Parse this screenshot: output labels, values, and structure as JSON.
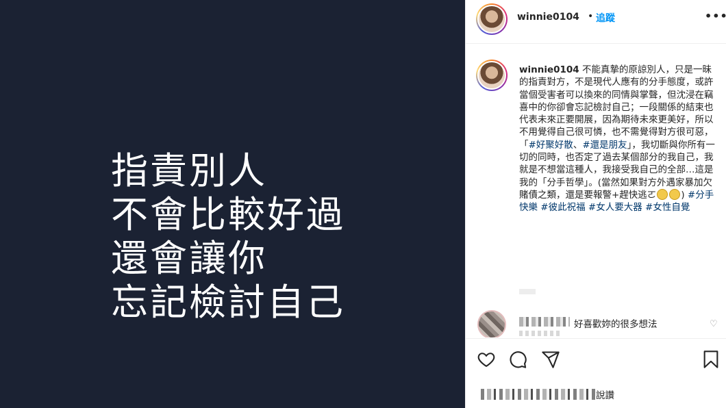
{
  "post_image": {
    "lines": [
      "指責別人",
      "不會比較好過",
      "還會讓你",
      "忘記檢討自己"
    ]
  },
  "header": {
    "username": "winnie0104",
    "separator": "•",
    "follow_label": "追蹤",
    "more_label": "•••"
  },
  "caption": {
    "username": "winnie0104",
    "text_1": "不能真摯的原諒別人，只是一昧的指責對方，不是現代人應有的分手態度，或許當個受害者可以換來的同情與掌聲，但沈浸在竊喜中的你卻會忘記檢討自己；一段關係的結束也代表未來正要開展，因為期待未來更美好，所以不用覺得自己很可憐，也不需覺得對方很可惡，「",
    "tag_1": "#好聚好散",
    "sep_1": "、",
    "tag_2": "#還是朋友",
    "text_2": "」，我切斷與你所有一切的同時，也否定了過去某個部分的我自己，我就是不想當這種人，我接受我自己的全部…這是我的「分手哲學」。(當然如果對方外遇家暴加欠賭債之類，還是要報警+趕快逃ㄛ",
    "text_3": ")",
    "tag_3": "#分手快樂",
    "tag_4": "#彼此祝福",
    "tag_5": "#女人要大器",
    "tag_6": "#女性自覺"
  },
  "reply": {
    "text": "好喜歡妳的很多想法",
    "heart_icon": "heart-outline-icon"
  },
  "actions": {
    "icons": [
      "heart-icon",
      "comment-icon",
      "share-icon",
      "bookmark-icon"
    ]
  },
  "likes": {
    "suffix": "說讚"
  }
}
